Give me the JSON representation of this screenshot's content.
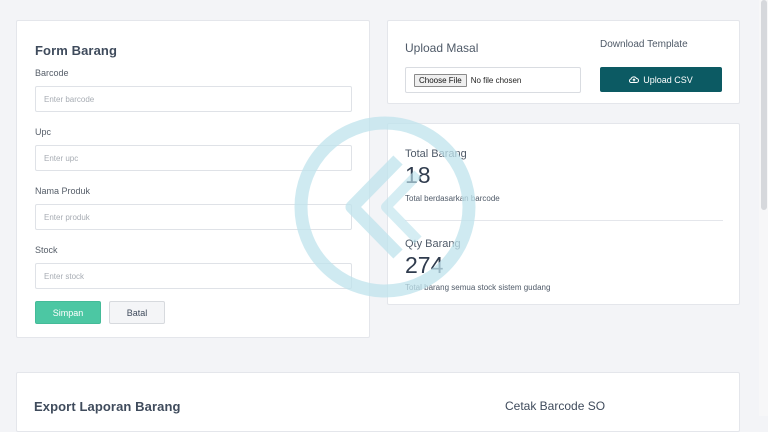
{
  "form": {
    "title": "Form Barang",
    "fields": [
      {
        "label": "Barcode",
        "placeholder": "Enter barcode"
      },
      {
        "label": "Upc",
        "placeholder": "Enter upc"
      },
      {
        "label": "Nama Produk",
        "placeholder": "Enter produk"
      },
      {
        "label": "Stock",
        "placeholder": "Enter stock"
      }
    ],
    "save_label": "Simpan",
    "cancel_label": "Batal"
  },
  "upload": {
    "title": "Upload Masal",
    "download_template_label": "Download Template",
    "choose_file_label": "Choose File",
    "no_file_text": "No file chosen",
    "upload_csv_label": "Upload CSV"
  },
  "stats": {
    "total_barang": {
      "label": "Total Barang",
      "value": "18",
      "desc": "Total berdasarkan barcode"
    },
    "qty_barang": {
      "label": "Qty Barang",
      "value": "274",
      "desc": "Total barang semua stock sistem gudang"
    }
  },
  "export": {
    "title": "Export Laporan Barang",
    "barcode_title": "Cetak Barcode SO"
  },
  "colors": {
    "primary_green": "#4cc7a3",
    "dark_teal": "#0c5a63",
    "watermark": "#bfe3ec"
  },
  "icons": {
    "upload": "cloud-upload-icon",
    "watermark": "watermark-logo-icon"
  }
}
